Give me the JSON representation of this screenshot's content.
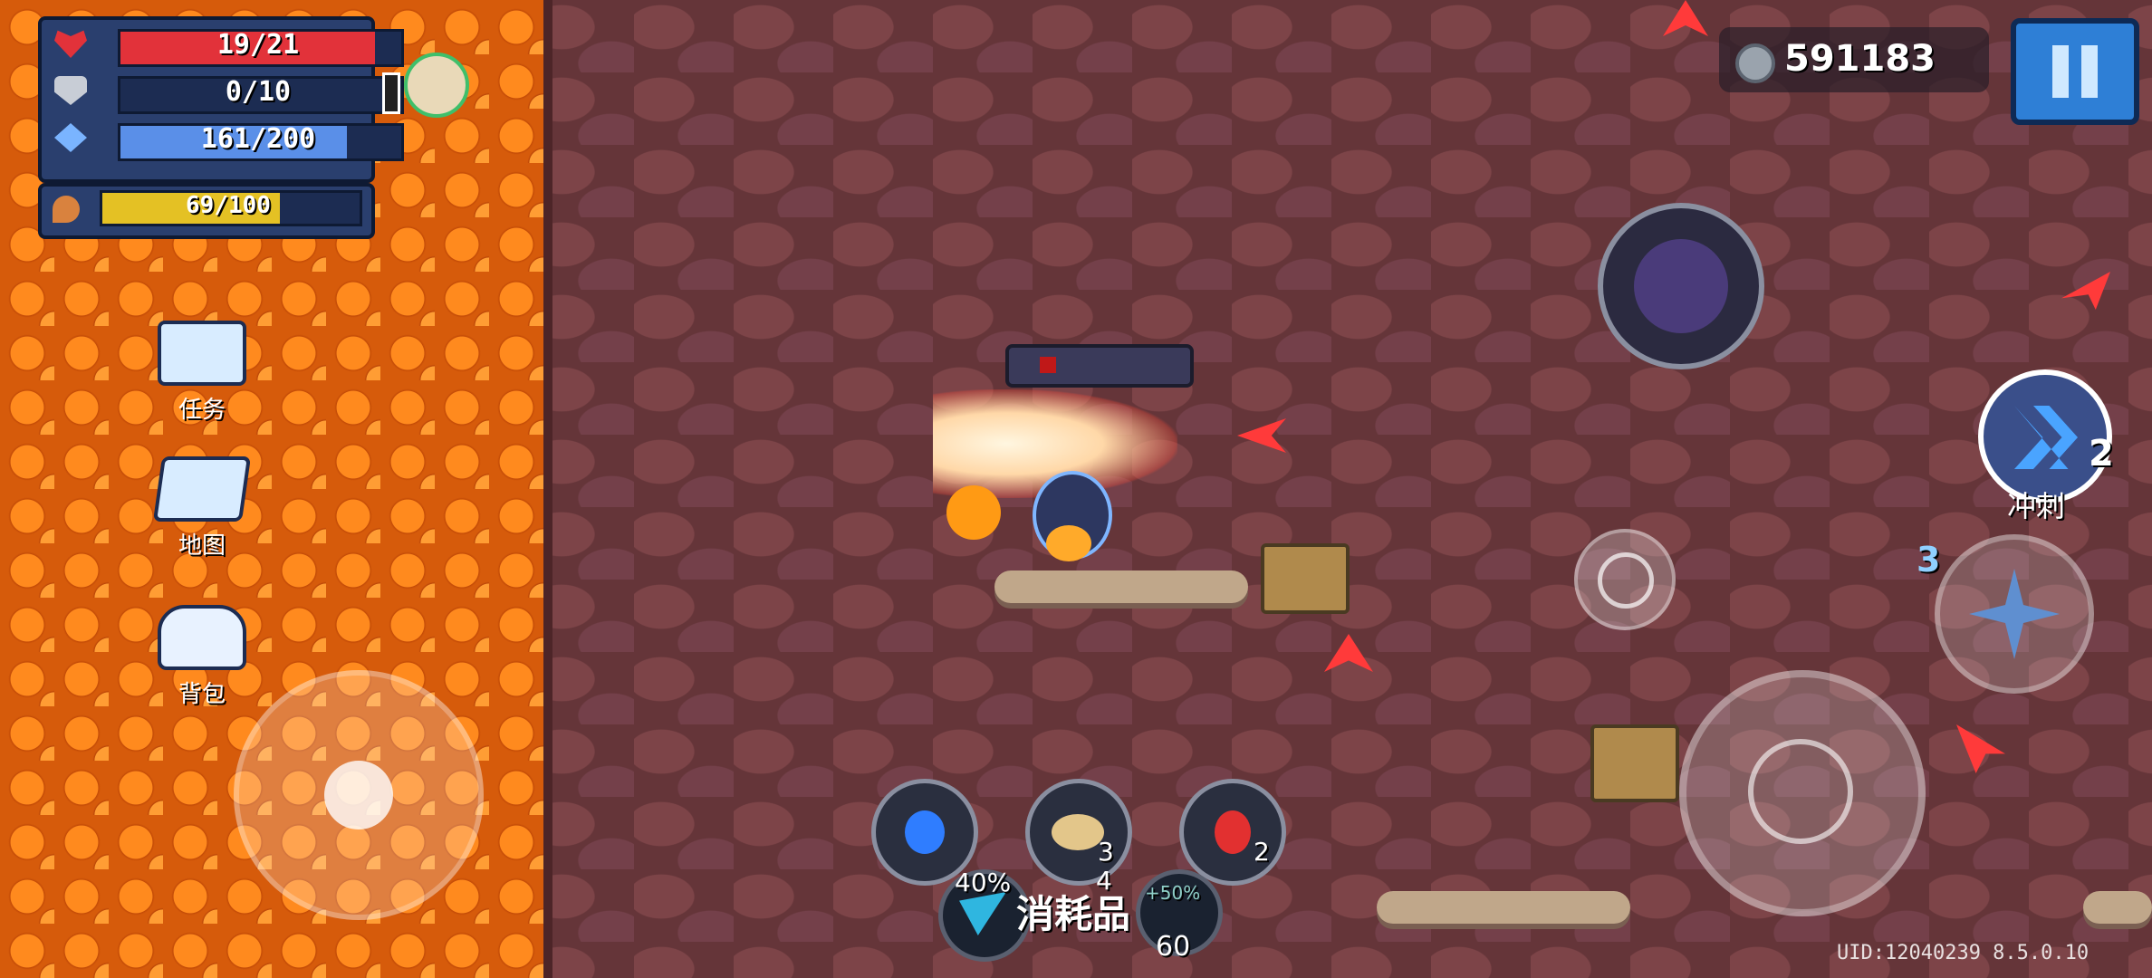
{
  "player": {
    "hp": "19/21",
    "hp_fraction": 0.905,
    "armor": "0/10",
    "armor_fraction": 0.0,
    "mana": "161/200",
    "mana_fraction": 0.805,
    "energy": "69/100",
    "energy_fraction": 0.69
  },
  "colors": {
    "hp": "#e2323a",
    "armor": "#3a76c9",
    "mana": "#5a8fe8",
    "energy": "#e4c124"
  },
  "menu": {
    "tasks": "任务",
    "map": "地图",
    "bag": "背包"
  },
  "currency": {
    "gems": "591183"
  },
  "skills": {
    "dash_label": "冲刺",
    "dash_count": "2",
    "weapon_count": "3"
  },
  "consumables": {
    "label": "消耗品",
    "blue_potion_count": "",
    "pie_count": "3",
    "red_potion_count": "2",
    "buff1_percent": "40%",
    "buff_mid_count": "4",
    "buff2_percent": "+50%",
    "buff2_count": "60"
  },
  "footer": {
    "uid": "UID:12040239  8.5.0.10"
  }
}
